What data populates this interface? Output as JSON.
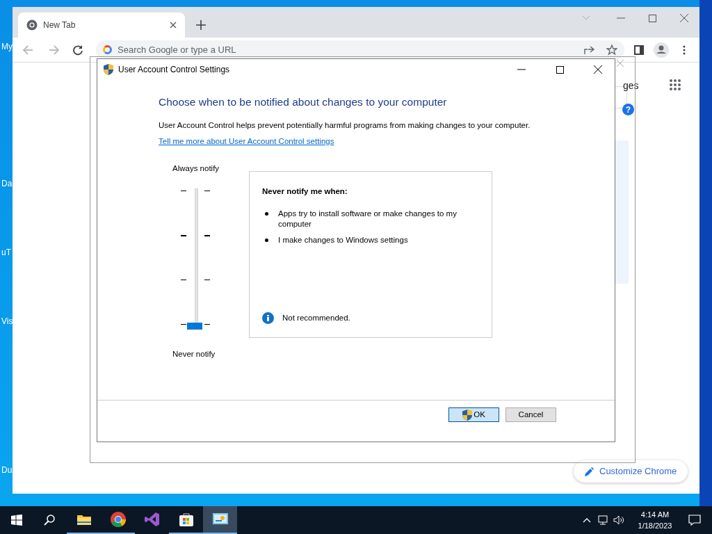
{
  "desktop_icons": [
    {
      "label": "My"
    },
    {
      "label": "Da"
    },
    {
      "label": "uT"
    },
    {
      "label": "Vis"
    },
    {
      "label": "Du"
    }
  ],
  "browser": {
    "tab": {
      "title": "New Tab",
      "selected": true
    },
    "omnibox": {
      "placeholder": "Search Google or type a URL"
    },
    "images_link": "ges",
    "help": "?",
    "customize": "Customize Chrome"
  },
  "dialog": {
    "title": "User Account Control Settings",
    "heading": "Choose when to be notified about changes to your computer",
    "description": "User Account Control helps prevent potentially harmful programs from making changes to your computer.",
    "link": "Tell me more about User Account Control settings",
    "slider": {
      "top_label": "Always notify",
      "bottom_label": "Never notify",
      "level": 0
    },
    "info": {
      "title": "Never notify me when:",
      "bullets": [
        "Apps try to install software or make changes to my computer",
        "I make changes to Windows settings"
      ],
      "note": "Not recommended."
    },
    "buttons": [
      {
        "label": "OK",
        "default": true
      },
      {
        "label": "Cancel",
        "default": false
      }
    ]
  },
  "taskbar": {
    "apps": [
      {
        "kind": "explorer",
        "running": true,
        "active": false
      },
      {
        "kind": "chrome",
        "running": true,
        "active": false
      },
      {
        "kind": "vs",
        "running": false,
        "active": false
      },
      {
        "kind": "store",
        "running": true,
        "active": false
      },
      {
        "kind": "control",
        "running": true,
        "active": true
      }
    ],
    "time": "4:14 AM",
    "date": "1/18/2023"
  }
}
